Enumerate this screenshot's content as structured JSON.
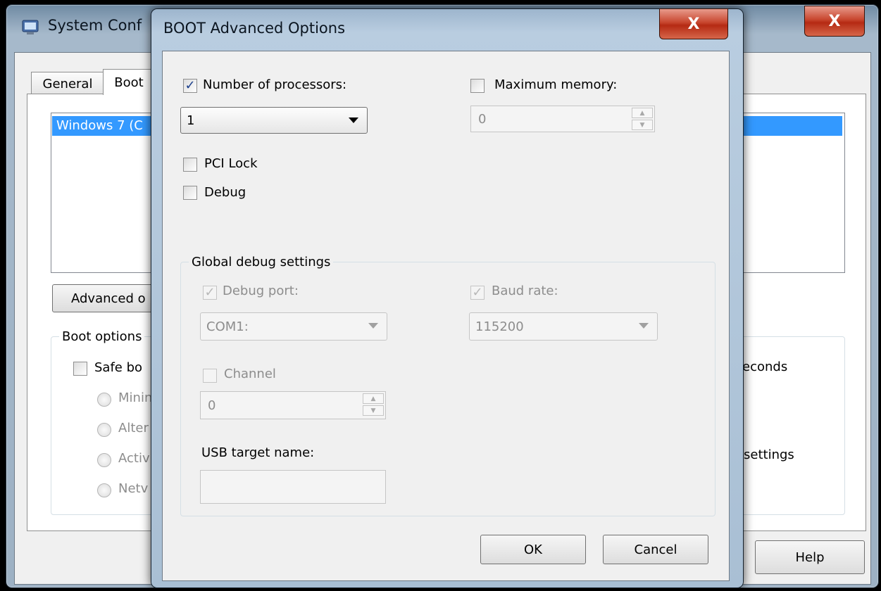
{
  "background_window": {
    "title": "System Conf",
    "close_glyph": "X",
    "tabs": [
      {
        "label": "General"
      },
      {
        "label": "Boot"
      }
    ],
    "os_list_item": "Windows 7 (C",
    "advanced_button_label": "Advanced o",
    "boot_options_label": "Boot options",
    "safe_boot_label": "Safe bo",
    "safe_boot_checked": false,
    "radio_labels": [
      "Minin",
      "Alter",
      "Activ",
      "Netv"
    ],
    "seconds_text": "econds",
    "settings_text": "settings",
    "help_button_label": "Help"
  },
  "dialog": {
    "title": "BOOT Advanced Options",
    "close_glyph": "X",
    "num_processors": {
      "label": "Number of processors:",
      "checked": true,
      "value": "1"
    },
    "max_memory": {
      "label": "Maximum memory:",
      "checked": false,
      "value": "0"
    },
    "pci_lock": {
      "label": "PCI Lock",
      "checked": false
    },
    "debug": {
      "label": "Debug",
      "checked": false
    },
    "global_debug": {
      "label": "Global debug settings",
      "debug_port": {
        "label": "Debug port:",
        "checked": true,
        "value": "COM1:"
      },
      "baud_rate": {
        "label": "Baud rate:",
        "checked": true,
        "value": "115200"
      },
      "channel": {
        "label": "Channel",
        "checked": false,
        "value": "0"
      },
      "usb_target_name": {
        "label": "USB target name:",
        "value": ""
      }
    },
    "ok_label": "OK",
    "cancel_label": "Cancel"
  },
  "icons": {
    "app_icon": "msconfig-app-icon",
    "dropdown": "chevron-down-icon",
    "spin_up": "arrow-up-icon",
    "spin_down": "arrow-down-icon",
    "close": "close-icon",
    "checkmark": "check-icon"
  },
  "colors": {
    "selection": "#3399ff",
    "titlebar": "#a9bfd4",
    "close_button": "#c8462e",
    "disabled_text": "#8d8d8d"
  }
}
